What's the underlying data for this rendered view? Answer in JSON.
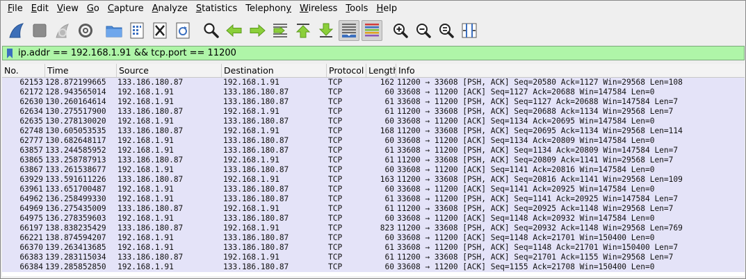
{
  "menu": {
    "items": [
      {
        "mn": "F",
        "rest": "ile"
      },
      {
        "mn": "E",
        "rest": "dit"
      },
      {
        "mn": "V",
        "rest": "iew"
      },
      {
        "mn": "G",
        "rest": "o"
      },
      {
        "mn": "C",
        "rest": "apture"
      },
      {
        "mn": "A",
        "rest": "nalyze"
      },
      {
        "mn": "S",
        "rest": "tatistics"
      },
      {
        "mn": "",
        "rest": "Telephony",
        "pre": "Telephon",
        "mid": "y",
        "post": ""
      },
      {
        "mn": "W",
        "rest": "ireless"
      },
      {
        "mn": "T",
        "rest": "ools"
      },
      {
        "mn": "H",
        "rest": "elp"
      }
    ]
  },
  "toolbar": {
    "icons": [
      "shark-fin-start-icon",
      "stop-capture-icon",
      "restart-capture-icon",
      "capture-options-gear-icon",
      "open-folder-icon",
      "save-file-icon",
      "close-file-icon",
      "reload-file-icon",
      "find-packet-icon",
      "go-back-icon",
      "go-forward-icon",
      "go-to-packet-icon",
      "go-first-packet-icon",
      "go-last-packet-icon",
      "autoscroll-icon",
      "colorize-icon",
      "zoom-in-icon",
      "zoom-out-icon",
      "zoom-normal-icon",
      "resize-columns-icon"
    ]
  },
  "filter": {
    "value": "ip.addr == 192.168.1.91 && tcp.port == 11200"
  },
  "packet_list": {
    "columns": [
      "No.",
      "Time",
      "Source",
      "Destination",
      "Protocol",
      "Length",
      "Info"
    ],
    "row_color": "#e4e3f8",
    "rows": [
      [
        "62153",
        "128.872199665",
        "133.186.180.87",
        "192.168.1.91",
        "TCP",
        "162",
        "11200 → 33608 [PSH, ACK] Seq=20580 Ack=1127 Win=29568 Len=108"
      ],
      [
        "62172",
        "128.943565014",
        "192.168.1.91",
        "133.186.180.87",
        "TCP",
        "60",
        "33608 → 11200 [ACK] Seq=1127 Ack=20688 Win=147584 Len=0"
      ],
      [
        "62630",
        "130.260164614",
        "192.168.1.91",
        "133.186.180.87",
        "TCP",
        "61",
        "33608 → 11200 [PSH, ACK] Seq=1127 Ack=20688 Win=147584 Len=7"
      ],
      [
        "62634",
        "130.275517900",
        "133.186.180.87",
        "192.168.1.91",
        "TCP",
        "61",
        "11200 → 33608 [PSH, ACK] Seq=20688 Ack=1134 Win=29568 Len=7"
      ],
      [
        "62635",
        "130.278130020",
        "192.168.1.91",
        "133.186.180.87",
        "TCP",
        "60",
        "33608 → 11200 [ACK] Seq=1134 Ack=20695 Win=147584 Len=0"
      ],
      [
        "62748",
        "130.605053535",
        "133.186.180.87",
        "192.168.1.91",
        "TCP",
        "168",
        "11200 → 33608 [PSH, ACK] Seq=20695 Ack=1134 Win=29568 Len=114"
      ],
      [
        "62777",
        "130.682648117",
        "192.168.1.91",
        "133.186.180.87",
        "TCP",
        "60",
        "33608 → 11200 [ACK] Seq=1134 Ack=20809 Win=147584 Len=0"
      ],
      [
        "63857",
        "133.244585952",
        "192.168.1.91",
        "133.186.180.87",
        "TCP",
        "61",
        "33608 → 11200 [PSH, ACK] Seq=1134 Ack=20809 Win=147584 Len=7"
      ],
      [
        "63865",
        "133.258787913",
        "133.186.180.87",
        "192.168.1.91",
        "TCP",
        "61",
        "11200 → 33608 [PSH, ACK] Seq=20809 Ack=1141 Win=29568 Len=7"
      ],
      [
        "63867",
        "133.261538677",
        "192.168.1.91",
        "133.186.180.87",
        "TCP",
        "60",
        "33608 → 11200 [ACK] Seq=1141 Ack=20816 Win=147584 Len=0"
      ],
      [
        "63929",
        "133.591611226",
        "133.186.180.87",
        "192.168.1.91",
        "TCP",
        "163",
        "11200 → 33608 [PSH, ACK] Seq=20816 Ack=1141 Win=29568 Len=109"
      ],
      [
        "63961",
        "133.651700487",
        "192.168.1.91",
        "133.186.180.87",
        "TCP",
        "60",
        "33608 → 11200 [ACK] Seq=1141 Ack=20925 Win=147584 Len=0"
      ],
      [
        "64962",
        "136.258499330",
        "192.168.1.91",
        "133.186.180.87",
        "TCP",
        "61",
        "33608 → 11200 [PSH, ACK] Seq=1141 Ack=20925 Win=147584 Len=7"
      ],
      [
        "64969",
        "136.275435009",
        "133.186.180.87",
        "192.168.1.91",
        "TCP",
        "61",
        "11200 → 33608 [PSH, ACK] Seq=20925 Ack=1148 Win=29568 Len=7"
      ],
      [
        "64975",
        "136.278359603",
        "192.168.1.91",
        "133.186.180.87",
        "TCP",
        "60",
        "33608 → 11200 [ACK] Seq=1148 Ack=20932 Win=147584 Len=0"
      ],
      [
        "66197",
        "138.838235429",
        "133.186.180.87",
        "192.168.1.91",
        "TCP",
        "823",
        "11200 → 33608 [PSH, ACK] Seq=20932 Ack=1148 Win=29568 Len=769"
      ],
      [
        "66221",
        "138.874594207",
        "192.168.1.91",
        "133.186.180.87",
        "TCP",
        "60",
        "33608 → 11200 [ACK] Seq=1148 Ack=21701 Win=150400 Len=0"
      ],
      [
        "66370",
        "139.263413685",
        "192.168.1.91",
        "133.186.180.87",
        "TCP",
        "61",
        "33608 → 11200 [PSH, ACK] Seq=1148 Ack=21701 Win=150400 Len=7"
      ],
      [
        "66383",
        "139.283115034",
        "133.186.180.87",
        "192.168.1.91",
        "TCP",
        "61",
        "11200 → 33608 [PSH, ACK] Seq=21701 Ack=1155 Win=29568 Len=7"
      ],
      [
        "66384",
        "139.285852850",
        "192.168.1.91",
        "133.186.180.87",
        "TCP",
        "60",
        "33608 → 11200 [ACK] Seq=1155 Ack=21708 Win=150400 Len=0"
      ]
    ]
  }
}
